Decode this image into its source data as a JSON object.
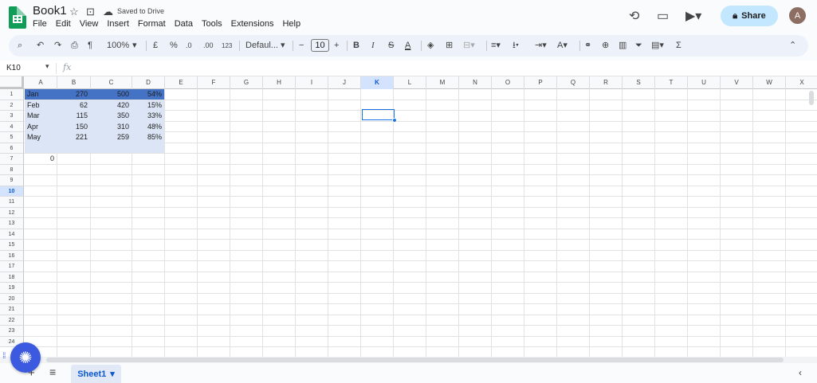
{
  "header": {
    "title": "Book1",
    "saved_status": "Saved to Drive",
    "share_label": "Share",
    "avatar_letter": "A",
    "menu": [
      "File",
      "Edit",
      "View",
      "Insert",
      "Format",
      "Data",
      "Tools",
      "Extensions",
      "Help"
    ]
  },
  "toolbar": {
    "zoom": "100%",
    "currency": "£",
    "percent": "%",
    "dec_decrease": ".0",
    "dec_increase": ".00",
    "number_format": "123",
    "font": "Defaul...",
    "font_size": "10",
    "minus": "−",
    "plus": "+",
    "bold": "B",
    "italic": "I",
    "strike": "S",
    "text_color": "A",
    "sigma": "Σ"
  },
  "formula_bar": {
    "name_box": "K10",
    "fx": "fx",
    "value": ""
  },
  "grid": {
    "columns": [
      "A",
      "B",
      "C",
      "D",
      "E",
      "F",
      "G",
      "H",
      "I",
      "J",
      "K",
      "L",
      "M",
      "N",
      "O",
      "P",
      "Q",
      "R",
      "S",
      "T",
      "U",
      "V",
      "W",
      "X"
    ],
    "selected_column": "K",
    "rows": [
      "1",
      "2",
      "3",
      "4",
      "5",
      "6",
      "7",
      "8",
      "9",
      "10",
      "11",
      "12",
      "13",
      "14",
      "15",
      "16",
      "17",
      "18",
      "19",
      "20",
      "21",
      "22",
      "23",
      "24"
    ],
    "selected_row": "10",
    "data": [
      {
        "a": "Jan",
        "b": "270",
        "c": "500",
        "d": "54%"
      },
      {
        "a": "Feb",
        "b": "62",
        "c": "420",
        "d": "15%"
      },
      {
        "a": "Mar",
        "b": "115",
        "c": "350",
        "d": "33%"
      },
      {
        "a": "Apr",
        "b": "150",
        "c": "310",
        "d": "48%"
      },
      {
        "a": "May",
        "b": "221",
        "c": "259",
        "d": "85%"
      }
    ],
    "a7": "0"
  },
  "sheets": {
    "active": "Sheet1"
  },
  "colors": {
    "header_row_fill": "#4472c4",
    "range_fill": "#dbe5f5",
    "selection": "#1a73e8",
    "share_bg": "#c2e7ff",
    "sheet_green": "#0f9d58"
  }
}
